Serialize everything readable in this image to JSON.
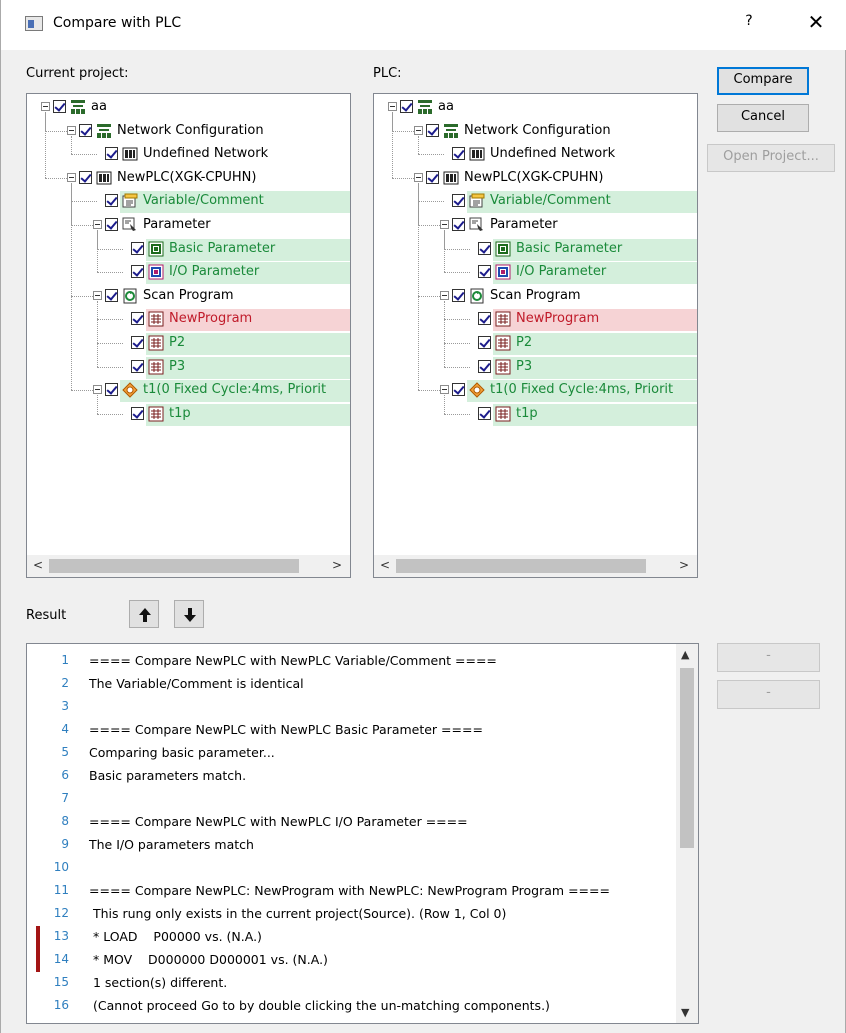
{
  "window": {
    "title": "Compare with PLC",
    "help": "?",
    "close": "✕"
  },
  "labels": {
    "current": "Current project:",
    "plc": "PLC:",
    "result": "Result"
  },
  "buttons": {
    "compare": "Compare",
    "cancel": "Cancel",
    "open_project": "Open Project...",
    "dash1": "-",
    "dash2": "-"
  },
  "tree": [
    {
      "label": "aa",
      "status": "none",
      "icon": "network-icon"
    },
    {
      "label": "Network Configuration",
      "status": "none",
      "icon": "network-icon"
    },
    {
      "label": "Undefined Network",
      "status": "none",
      "icon": "plc-icon"
    },
    {
      "label": "NewPLC(XGK-CPUHN)",
      "status": "none",
      "icon": "plc-icon"
    },
    {
      "label": "Variable/Comment",
      "status": "match",
      "icon": "variable-icon"
    },
    {
      "label": "Parameter",
      "status": "none",
      "icon": "parameter-icon"
    },
    {
      "label": "Basic Parameter",
      "status": "match",
      "icon": "basic-parameter-icon"
    },
    {
      "label": "I/O Parameter",
      "status": "match",
      "icon": "io-parameter-icon"
    },
    {
      "label": "Scan Program",
      "status": "none",
      "icon": "scan-program-icon"
    },
    {
      "label": "NewProgram",
      "status": "diff",
      "icon": "program-icon"
    },
    {
      "label": "P2",
      "status": "match",
      "icon": "program-icon"
    },
    {
      "label": "P3",
      "status": "match",
      "icon": "program-icon"
    },
    {
      "label": "t1(0 Fixed Cycle:4ms, Priorit",
      "status": "match",
      "icon": "task-icon"
    },
    {
      "label": "t1p",
      "status": "match",
      "icon": "program-icon"
    }
  ],
  "result_lines": [
    {
      "num": "1",
      "text": "==== Compare NewPLC with NewPLC Variable/Comment ===="
    },
    {
      "num": "2",
      "text": "The Variable/Comment is identical"
    },
    {
      "num": "3",
      "text": ""
    },
    {
      "num": "4",
      "text": "==== Compare NewPLC with NewPLC Basic Parameter ===="
    },
    {
      "num": "5",
      "text": "Comparing basic parameter..."
    },
    {
      "num": "6",
      "text": "Basic parameters match."
    },
    {
      "num": "7",
      "text": ""
    },
    {
      "num": "8",
      "text": "==== Compare NewPLC with NewPLC I/O Parameter ===="
    },
    {
      "num": "9",
      "text": "The I/O parameters match"
    },
    {
      "num": "10",
      "text": ""
    },
    {
      "num": "11",
      "text": "==== Compare NewPLC: NewProgram with NewPLC: NewProgram Program ===="
    },
    {
      "num": "12",
      "text": " This rung only exists in the current project(Source). (Row 1, Col 0)"
    },
    {
      "num": "13",
      "text": " * LOAD    P00000 vs. (N.A.)"
    },
    {
      "num": "14",
      "text": " * MOV    D000000 D000001 vs. (N.A.)"
    },
    {
      "num": "15",
      "text": " 1 section(s) different."
    },
    {
      "num": "16",
      "text": " (Cannot proceed Go to by double clicking the un-matching components.)"
    }
  ],
  "colors": {
    "match_bg": "#d4efdc",
    "match_text": "#1a8a3a",
    "diff_bg": "#f6d3d5",
    "diff_text": "#c01b2a",
    "accent": "#0078d7",
    "marker": "#a31515"
  }
}
